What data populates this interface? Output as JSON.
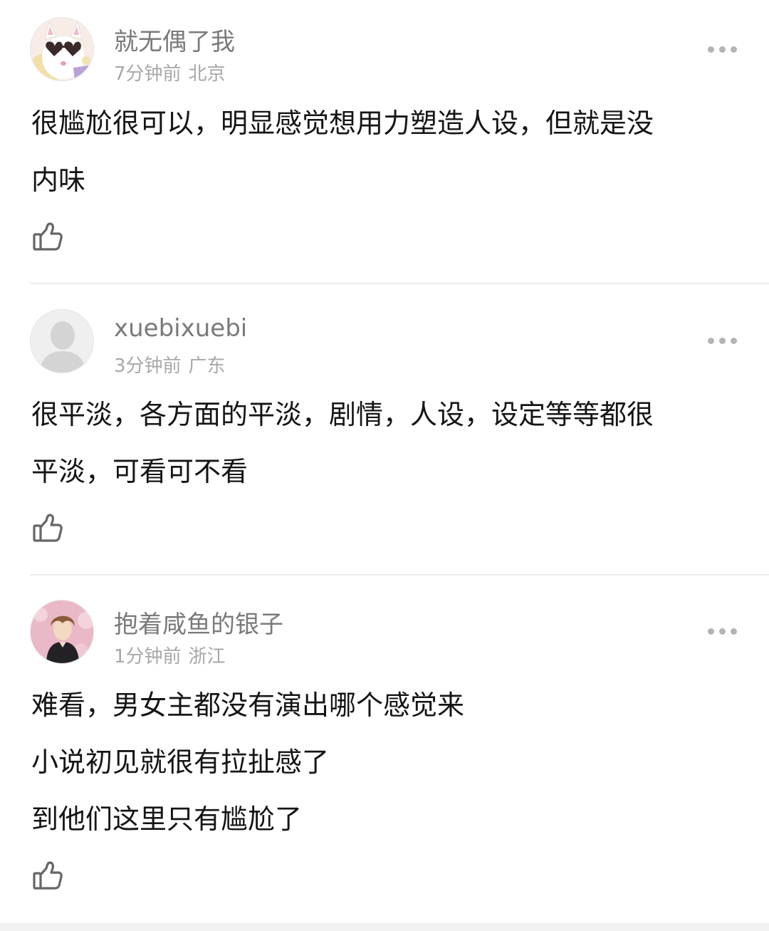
{
  "comments": [
    {
      "username": "就无偶了我",
      "time": "7分钟前",
      "location": "北京",
      "lines": [
        "很尴尬很可以，明显感觉想用力塑造人设，但就是没",
        "内味"
      ],
      "avatar": "cat-with-heart-sunglasses"
    },
    {
      "username": "xuebixuebi",
      "time": "3分钟前",
      "location": "广东",
      "lines": [
        "很平淡，各方面的平淡，剧情，人设，设定等等都很",
        "平淡，可看可不看"
      ],
      "avatar": "default-user-silhouette"
    },
    {
      "username": "抱着咸鱼的银子",
      "time": "1分钟前",
      "location": "浙江",
      "lines": [
        "难看，男女主都没有演出哪个感觉来",
        "小说初见就很有拉扯感了",
        "到他们这里只有尴尬了"
      ],
      "avatar": "anime-boy-uniform"
    }
  ],
  "icons": {
    "like": "thumbs-up-icon",
    "more": "more-horizontal-icon"
  },
  "colors": {
    "username": "#7a7a7a",
    "meta": "#a8a8a8",
    "text": "#151515",
    "divider": "#ededed"
  }
}
